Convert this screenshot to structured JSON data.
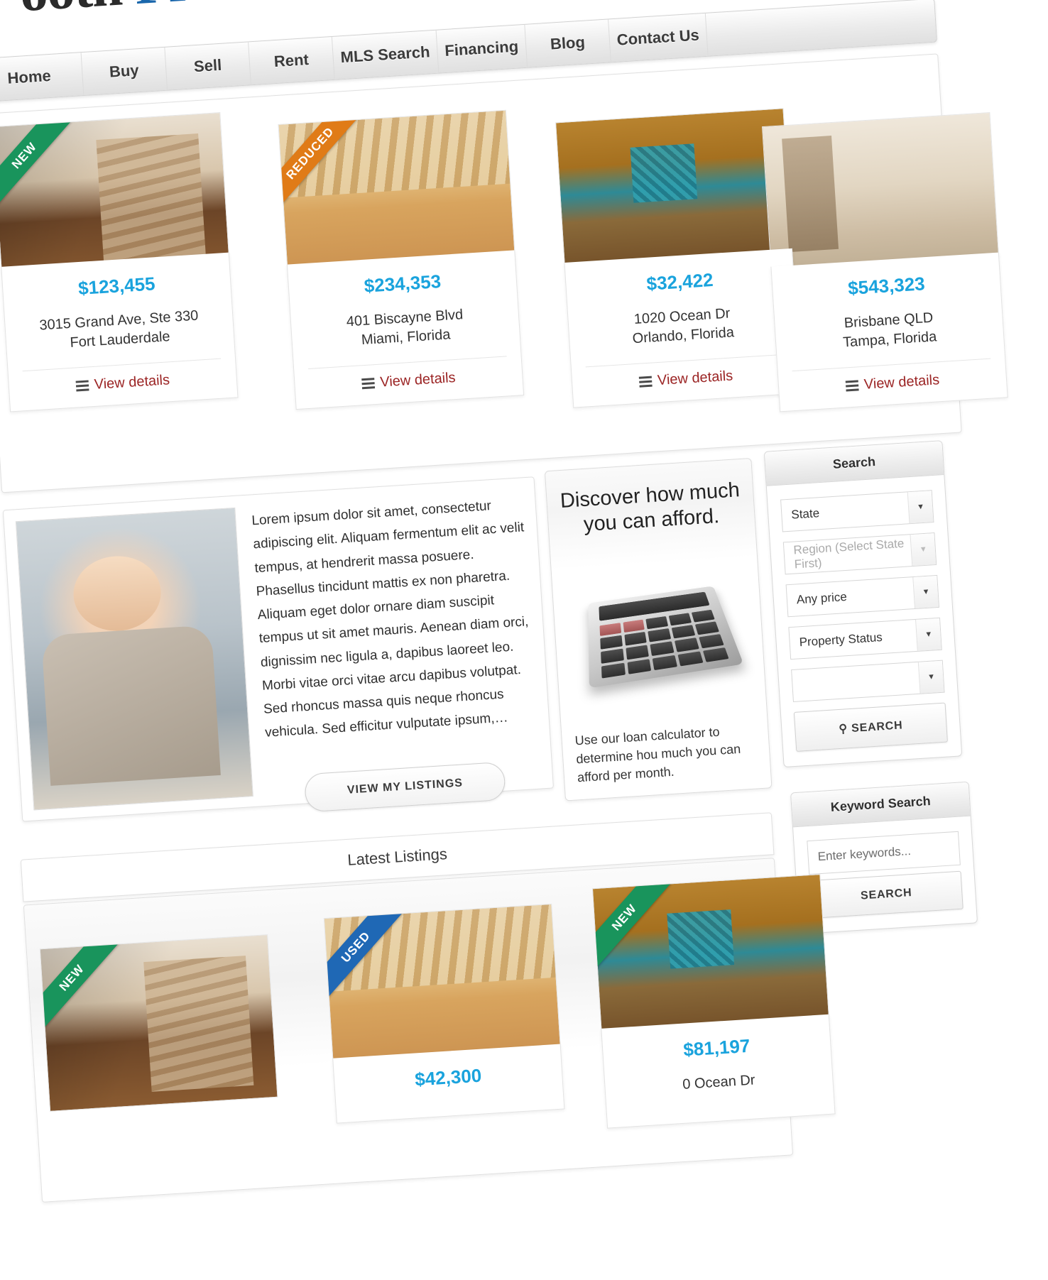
{
  "site": {
    "logo_dark": "ooth",
    "logo_blue": "Pro"
  },
  "nav": {
    "items": [
      {
        "label": "Home"
      },
      {
        "label": "Buy"
      },
      {
        "label": "Sell"
      },
      {
        "label": "Rent"
      },
      {
        "label": "MLS Search"
      },
      {
        "label": "Financing"
      },
      {
        "label": "Blog"
      },
      {
        "label": "Contact Us"
      }
    ]
  },
  "featured": {
    "view_details_label": "View details",
    "cards": [
      {
        "ribbon": "NEW",
        "ribbon_type": "new",
        "price": "$123,455",
        "address_line1": "3015 Grand Ave, Ste 330",
        "address_line2": "Fort Lauderdale",
        "photo": "stairs-interior-photo"
      },
      {
        "ribbon": "REDUCED",
        "ribbon_type": "reduced",
        "price": "$234,353",
        "address_line1": "401 Biscayne Blvd",
        "address_line2": "Miami, Florida",
        "photo": "living-room-photo"
      },
      {
        "ribbon": "",
        "ribbon_type": "none",
        "price": "$32,422",
        "address_line1": "1020 Ocean Dr",
        "address_line2": "Orlando, Florida",
        "photo": "kitchen-photo"
      },
      {
        "ribbon": "",
        "ribbon_type": "none",
        "price": "$543,323",
        "address_line1": "Brisbane QLD",
        "address_line2": "Tampa, Florida",
        "photo": "marble-hall-photo"
      }
    ]
  },
  "agent": {
    "photo_alt": "smiling-agent-photo",
    "body_text": "Lorem ipsum dolor sit amet, consectetur adipiscing elit. Aliquam fermentum elit ac velit tempus, at hendrerit massa posuere. Phasellus tincidunt mattis ex non pharetra. Aliquam eget dolor ornare diam suscipit tempus ut sit amet mauris. Aenean diam orci, dignissim nec ligula a, dapibus laoreet leo. Morbi vitae orci vitae arcu dapibus volutpat. Sed rhoncus massa quis neque rhoncus vehicula. Sed efficitur vulputate ipsum,…",
    "button_label": "VIEW MY LISTINGS"
  },
  "calculator": {
    "title_line1": "Discover how much",
    "title_line2": "you can afford.",
    "caption": "Use our loan calculator to determine hou much you can afford per month."
  },
  "search_panel": {
    "title": "Search",
    "fields": [
      {
        "value": "State",
        "disabled": false,
        "name": "state-select"
      },
      {
        "value": "Region (Select State First)",
        "disabled": true,
        "name": "region-select"
      },
      {
        "value": "Any price",
        "disabled": false,
        "name": "price-select"
      },
      {
        "value": "Property Status",
        "disabled": false,
        "name": "property-status-select"
      },
      {
        "value": "",
        "disabled": false,
        "name": "extra-select"
      }
    ],
    "button_label": "SEARCH",
    "button_icon": "magnifier-icon"
  },
  "keyword_panel": {
    "title": "Keyword Search",
    "input_placeholder": "Enter keywords...",
    "input_value": "",
    "button_label": "SEARCH"
  },
  "latest": {
    "title": "Latest Listings",
    "cards": [
      {
        "ribbon": "NEW",
        "ribbon_type": "new",
        "price": "",
        "address_line1": "",
        "photo": "stairs-interior-photo"
      },
      {
        "ribbon": "USED",
        "ribbon_type": "used",
        "price": "$42,300",
        "address_line1": "",
        "photo": "living-room-photo"
      },
      {
        "ribbon": "NEW",
        "ribbon_type": "new",
        "price": "$81,197",
        "address_line1": "0 Ocean Dr",
        "photo": "kitchen-photo"
      }
    ]
  },
  "colors": {
    "price_blue": "#1aa3dd",
    "link_red": "#9b2424",
    "ribbon_new": "#19945c",
    "ribbon_reduced": "#e07b17",
    "ribbon_used": "#1f68b5",
    "logo_blue": "#1a6fb5"
  }
}
